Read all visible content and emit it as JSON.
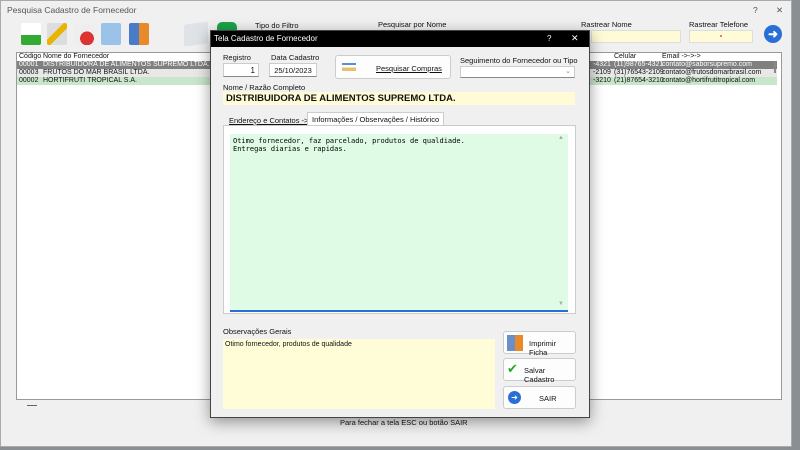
{
  "main": {
    "title": "Pesquisa Cadastro de Fornecedor",
    "help": "?",
    "close": "✕",
    "filter_type_label": "Tipo do Filtro",
    "search_name_label": "Pesquisar por Nome",
    "track_name_label": "Rastrear Nome",
    "track_name_value": "",
    "track_phone_label": "Rastrear Telefone",
    "track_phone_value": "-",
    "footer": "Para fechar a tela ESC ou botão SAIR"
  },
  "list": {
    "headers": {
      "code": "Código",
      "name": "Nome do Fornecedor",
      "cel": "Celular",
      "email": "Email ->->->"
    },
    "rows": [
      {
        "code": "00001",
        "name": "DISTRIBUIDORA DE ALIMENTOS SUPREMO LTDA.",
        "phone": "-4321",
        "cel": "(11)98765-4321",
        "email": "contato@saborsupremo.com",
        "bg": "#808080",
        "fg": "#ffffff"
      },
      {
        "code": "00003",
        "name": "FRUTOS DO MAR BRASIL LTDA.",
        "phone": "-2109",
        "cel": "(31)76543-2109",
        "email": "contato@frutosdomarbrasil.com",
        "bg": "#e8e8e8",
        "fg": "#111111"
      },
      {
        "code": "00002",
        "name": "HORTIFRUTI TROPICAL S.A.",
        "phone": "-3210",
        "cel": "(21)87654-3210",
        "email": "contato@hortifrutitropical.com",
        "bg": "#c8e6c9",
        "fg": "#111111"
      }
    ]
  },
  "dialog": {
    "title": "Tela Cadastro de Fornecedor",
    "help": "?",
    "close": "✕",
    "registro_label": "Registro",
    "registro_value": "1",
    "data_label": "Data Cadastro",
    "data_value": "25/10/2023",
    "pesquisar_compras": "Pesquisar Compras",
    "segmento_label": "Seguimento do Fornecedor ou Tipo",
    "segmento_value": "",
    "nome_label": "Nome / Razão Completo",
    "nome_value": "DISTRIBUIDORA DE ALIMENTOS SUPREMO LTDA.",
    "tabs": [
      "Endereço e Contatos ->",
      "Informações / Observações / Histórico"
    ],
    "info_text": "Otimo fornecedor, faz parcelado, produtos de qualdiade.\nEntregas diarias e rapidas.",
    "obs_label": "Observações Gerais",
    "obs_value": "Otimo fornecedor, produtos de qualidade",
    "imprimir": "Imprimir Ficha",
    "salvar": "Salvar Cadastro",
    "sair": "SAIR"
  }
}
